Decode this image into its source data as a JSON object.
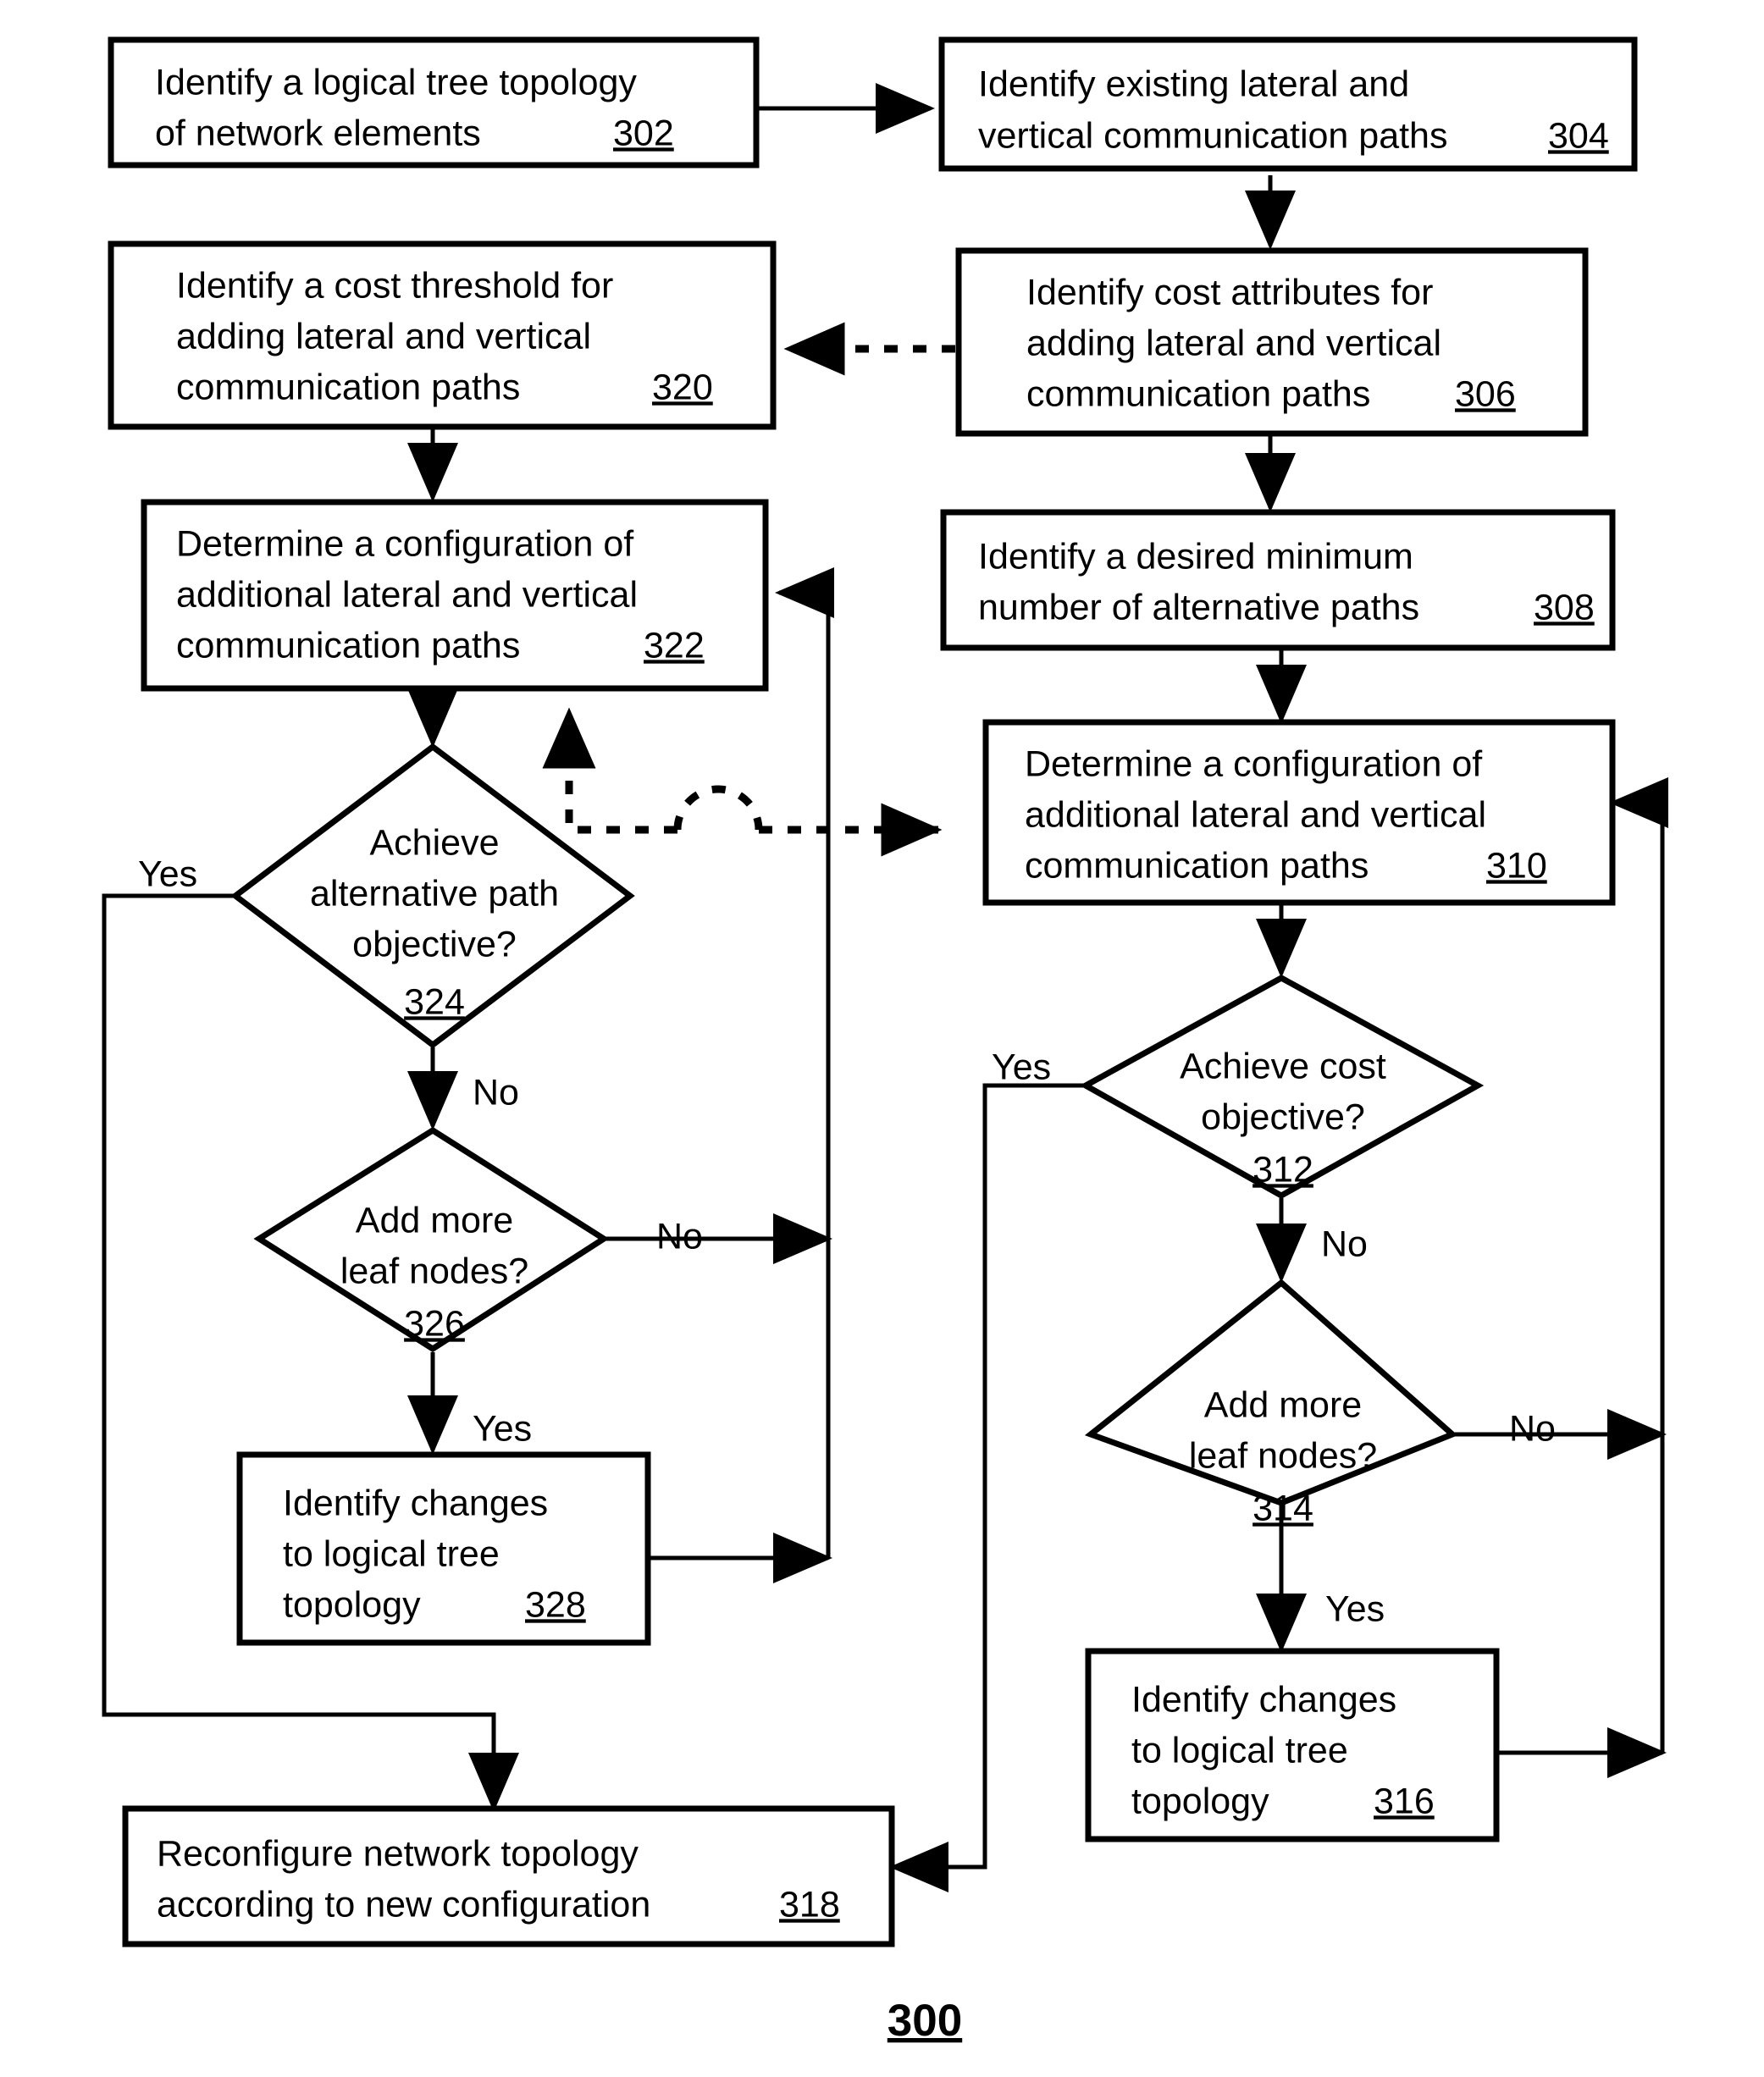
{
  "figure": {
    "label": "300"
  },
  "nodes": [
    {
      "id": "302",
      "shape": "rect",
      "lines": [
        "Identify a logical tree topology",
        "of network elements"
      ],
      "ref": "302"
    },
    {
      "id": "304",
      "shape": "rect",
      "lines": [
        "Identify existing lateral and",
        "vertical communication paths"
      ],
      "ref": "304"
    },
    {
      "id": "320",
      "shape": "rect",
      "lines": [
        "Identify a cost threshold for",
        "adding lateral and vertical",
        "communication paths"
      ],
      "ref": "320"
    },
    {
      "id": "306",
      "shape": "rect",
      "lines": [
        "Identify cost attributes for",
        "adding lateral and vertical",
        "communication paths"
      ],
      "ref": "306"
    },
    {
      "id": "322",
      "shape": "rect",
      "lines": [
        "Determine a configuration of",
        "additional lateral and vertical",
        "communication paths"
      ],
      "ref": "322"
    },
    {
      "id": "308",
      "shape": "rect",
      "lines": [
        "Identify a desired minimum",
        "number of alternative paths"
      ],
      "ref": "308"
    },
    {
      "id": "310",
      "shape": "rect",
      "lines": [
        "Determine a configuration of",
        "additional lateral and vertical",
        "communication paths"
      ],
      "ref": "310"
    },
    {
      "id": "324",
      "shape": "diamond",
      "lines": [
        "Achieve",
        "alternative path",
        "objective?"
      ],
      "ref": "324"
    },
    {
      "id": "312",
      "shape": "diamond",
      "lines": [
        "Achieve cost",
        "objective?"
      ],
      "ref": "312"
    },
    {
      "id": "326",
      "shape": "diamond",
      "lines": [
        "Add more",
        "leaf nodes?"
      ],
      "ref": "326"
    },
    {
      "id": "314",
      "shape": "diamond",
      "lines": [
        "Add more",
        "leaf nodes?"
      ],
      "ref": "314"
    },
    {
      "id": "328",
      "shape": "rect",
      "lines": [
        "Identify changes",
        "to logical tree",
        "topology"
      ],
      "ref": "328"
    },
    {
      "id": "316",
      "shape": "rect",
      "lines": [
        "Identify changes",
        "to logical tree",
        "topology"
      ],
      "ref": "316"
    },
    {
      "id": "318",
      "shape": "rect",
      "lines": [
        "Reconfigure network topology",
        "according to new configuration"
      ],
      "ref": "318"
    }
  ],
  "node_text": {
    "n302_l1": "Identify a logical tree topology",
    "n302_l2": "of network elements",
    "n302_ref": "302",
    "n304_l1": "Identify existing lateral and",
    "n304_l2": "vertical communication paths",
    "n304_ref": "304",
    "n320_l1": "Identify a cost threshold for",
    "n320_l2": "adding lateral and vertical",
    "n320_l3": "communication paths",
    "n320_ref": "320",
    "n306_l1": "Identify cost attributes for",
    "n306_l2": "adding lateral and vertical",
    "n306_l3": "communication paths",
    "n306_ref": "306",
    "n322_l1": "Determine a configuration of",
    "n322_l2": "additional lateral and vertical",
    "n322_l3": "communication paths",
    "n322_ref": "322",
    "n308_l1": "Identify a desired minimum",
    "n308_l2": "number of alternative paths",
    "n308_ref": "308",
    "n310_l1": "Determine a configuration of",
    "n310_l2": "additional lateral and vertical",
    "n310_l3": "communication paths",
    "n310_ref": "310",
    "n324_l1": "Achieve",
    "n324_l2": "alternative path",
    "n324_l3": "objective?",
    "n324_ref": "324",
    "n312_l1": "Achieve cost",
    "n312_l2": "objective?",
    "n312_ref": "312",
    "n326_l1": "Add more",
    "n326_l2": "leaf nodes?",
    "n326_ref": "326",
    "n314_l1": "Add more",
    "n314_l2": "leaf nodes?",
    "n314_ref": "314",
    "n328_l1": "Identify changes",
    "n328_l2": "to logical tree",
    "n328_l3": "topology",
    "n328_ref": "328",
    "n316_l1": "Identify changes",
    "n316_l2": "to logical tree",
    "n316_l3": "topology",
    "n316_ref": "316",
    "n318_l1": "Reconfigure network topology",
    "n318_l2": "according to new configuration",
    "n318_ref": "318"
  },
  "edge_labels": {
    "yes_324": "Yes",
    "no_324": "No",
    "no_326": "No",
    "yes_326": "Yes",
    "yes_312": "Yes",
    "no_312": "No",
    "no_314": "No",
    "yes_314": "Yes"
  },
  "colors": {
    "line": "#000000",
    "fill": "#ffffff",
    "text": "#000000"
  }
}
